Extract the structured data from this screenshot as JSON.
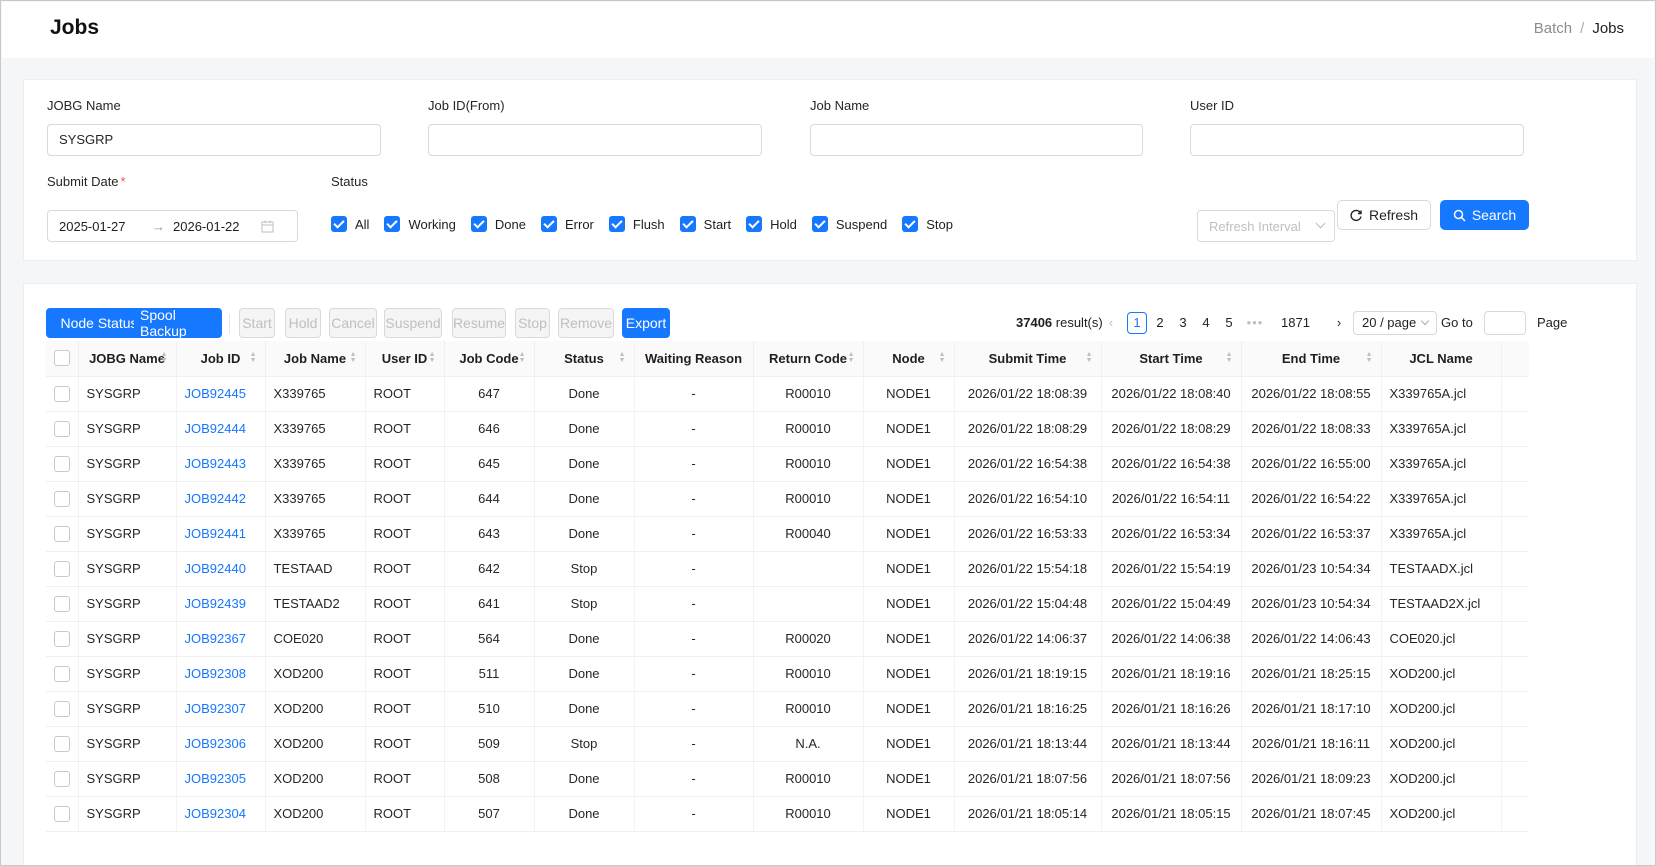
{
  "header": {
    "title": "Jobs",
    "breadcrumb": [
      "Batch",
      "Jobs"
    ]
  },
  "filters": {
    "jobg_name": {
      "label": "JOBG Name",
      "value": "SYSGRP"
    },
    "job_id_from": {
      "label": "Job ID(From)",
      "value": ""
    },
    "job_name": {
      "label": "Job Name",
      "value": ""
    },
    "user_id": {
      "label": "User ID",
      "value": ""
    },
    "submit_date": {
      "label": "Submit Date",
      "required_mark": "*",
      "from": "2025-01-27",
      "arrow": "→",
      "to": "2026-01-22"
    },
    "status": {
      "label": "Status",
      "options": [
        "All",
        "Working",
        "Done",
        "Error",
        "Flush",
        "Start",
        "Hold",
        "Suspend",
        "Stop"
      ]
    },
    "refresh_interval_placeholder": "Refresh Interval",
    "refresh_label": "Refresh",
    "search_label": "Search"
  },
  "toolbar": {
    "buttons": [
      {
        "label": "Node Status",
        "enabled": true
      },
      {
        "label": "Spool Backup",
        "enabled": true
      },
      {
        "label": "Start",
        "enabled": false
      },
      {
        "label": "Hold",
        "enabled": false
      },
      {
        "label": "Cancel",
        "enabled": false
      },
      {
        "label": "Suspend",
        "enabled": false
      },
      {
        "label": "Resume",
        "enabled": false
      },
      {
        "label": "Stop",
        "enabled": false
      },
      {
        "label": "Remove",
        "enabled": false
      },
      {
        "label": "Export",
        "enabled": true
      }
    ]
  },
  "pagination": {
    "total": "37406",
    "total_suffix": " result(s)",
    "pages": [
      "1",
      "2",
      "3",
      "4",
      "5"
    ],
    "dots": "•••",
    "last_page": "1871",
    "current": "1",
    "page_size": "20 / page",
    "goto_label": "Go to",
    "page_label": "Page"
  },
  "table": {
    "columns": [
      "JOBG Name",
      "Job ID",
      "Job Name",
      "User ID",
      "Job Code",
      "Status",
      "Waiting Reason",
      "Return Code",
      "Node",
      "Submit Time",
      "Start Time",
      "End Time",
      "JCL Name"
    ],
    "rows": [
      [
        "SYSGRP",
        "JOB92445",
        "X339765",
        "ROOT",
        "647",
        "Done",
        "-",
        "R00010",
        "NODE1",
        "2026/01/22 18:08:39",
        "2026/01/22 18:08:40",
        "2026/01/22 18:08:55",
        "X339765A.jcl"
      ],
      [
        "SYSGRP",
        "JOB92444",
        "X339765",
        "ROOT",
        "646",
        "Done",
        "-",
        "R00010",
        "NODE1",
        "2026/01/22 18:08:29",
        "2026/01/22 18:08:29",
        "2026/01/22 18:08:33",
        "X339765A.jcl"
      ],
      [
        "SYSGRP",
        "JOB92443",
        "X339765",
        "ROOT",
        "645",
        "Done",
        "-",
        "R00010",
        "NODE1",
        "2026/01/22 16:54:38",
        "2026/01/22 16:54:38",
        "2026/01/22 16:55:00",
        "X339765A.jcl"
      ],
      [
        "SYSGRP",
        "JOB92442",
        "X339765",
        "ROOT",
        "644",
        "Done",
        "-",
        "R00010",
        "NODE1",
        "2026/01/22 16:54:10",
        "2026/01/22 16:54:11",
        "2026/01/22 16:54:22",
        "X339765A.jcl"
      ],
      [
        "SYSGRP",
        "JOB92441",
        "X339765",
        "ROOT",
        "643",
        "Done",
        "-",
        "R00040",
        "NODE1",
        "2026/01/22 16:53:33",
        "2026/01/22 16:53:34",
        "2026/01/22 16:53:37",
        "X339765A.jcl"
      ],
      [
        "SYSGRP",
        "JOB92440",
        "TESTAAD",
        "ROOT",
        "642",
        "Stop",
        "-",
        "",
        "NODE1",
        "2026/01/22 15:54:18",
        "2026/01/22 15:54:19",
        "2026/01/23 10:54:34",
        "TESTAADX.jcl"
      ],
      [
        "SYSGRP",
        "JOB92439",
        "TESTAAD2",
        "ROOT",
        "641",
        "Stop",
        "-",
        "",
        "NODE1",
        "2026/01/22 15:04:48",
        "2026/01/22 15:04:49",
        "2026/01/23 10:54:34",
        "TESTAAD2X.jcl"
      ],
      [
        "SYSGRP",
        "JOB92367",
        "COE020",
        "ROOT",
        "564",
        "Done",
        "-",
        "R00020",
        "NODE1",
        "2026/01/22 14:06:37",
        "2026/01/22 14:06:38",
        "2026/01/22 14:06:43",
        "COE020.jcl"
      ],
      [
        "SYSGRP",
        "JOB92308",
        "XOD200",
        "ROOT",
        "511",
        "Done",
        "-",
        "R00010",
        "NODE1",
        "2026/01/21 18:19:15",
        "2026/01/21 18:19:16",
        "2026/01/21 18:25:15",
        "XOD200.jcl"
      ],
      [
        "SYSGRP",
        "JOB92307",
        "XOD200",
        "ROOT",
        "510",
        "Done",
        "-",
        "R00010",
        "NODE1",
        "2026/01/21 18:16:25",
        "2026/01/21 18:16:26",
        "2026/01/21 18:17:10",
        "XOD200.jcl"
      ],
      [
        "SYSGRP",
        "JOB92306",
        "XOD200",
        "ROOT",
        "509",
        "Stop",
        "-",
        "N.A.",
        "NODE1",
        "2026/01/21 18:13:44",
        "2026/01/21 18:13:44",
        "2026/01/21 18:16:11",
        "XOD200.jcl"
      ],
      [
        "SYSGRP",
        "JOB92305",
        "XOD200",
        "ROOT",
        "508",
        "Done",
        "-",
        "R00010",
        "NODE1",
        "2026/01/21 18:07:56",
        "2026/01/21 18:07:56",
        "2026/01/21 18:09:23",
        "XOD200.jcl"
      ],
      [
        "SYSGRP",
        "JOB92304",
        "XOD200",
        "ROOT",
        "507",
        "Done",
        "-",
        "R00010",
        "NODE1",
        "2026/01/21 18:05:14",
        "2026/01/21 18:05:15",
        "2026/01/21 18:07:45",
        "XOD200.jcl"
      ]
    ]
  }
}
